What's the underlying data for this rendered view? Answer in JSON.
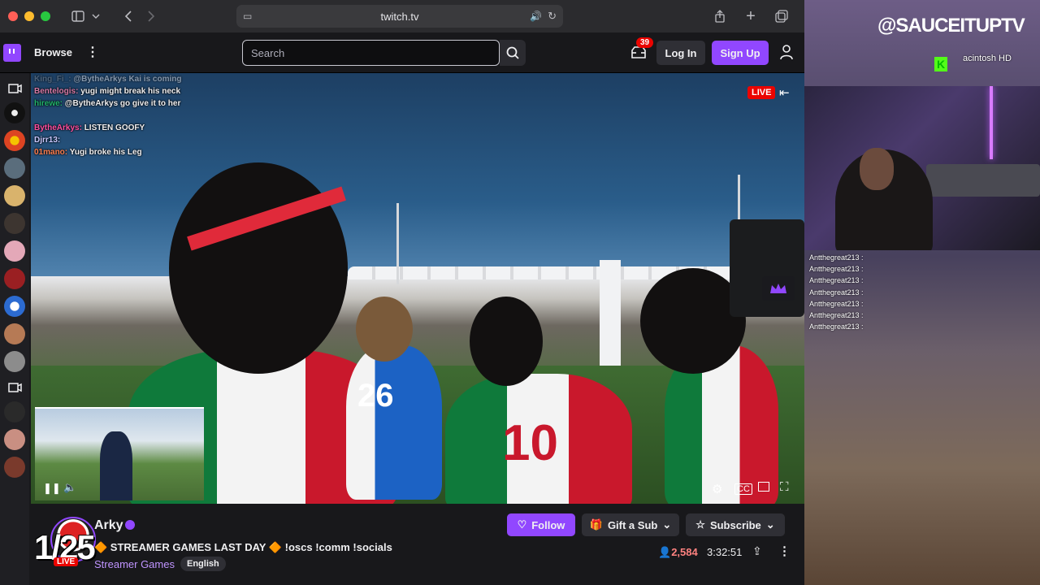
{
  "browser": {
    "url": "twitch.tv",
    "colors": {
      "close": "#ff5f57",
      "minimize": "#febc2e",
      "zoom": "#28c840"
    }
  },
  "nav": {
    "browse_label": "Browse",
    "search_placeholder": "Search",
    "notification_count": "39",
    "login_label": "Log In",
    "signup_label": "Sign Up"
  },
  "player": {
    "live_label": "LIVE",
    "chat_lines": [
      {
        "user": "King_Fi_:",
        "msg": "@BytheArkys Kai is coming",
        "color": "#6b7a8a"
      },
      {
        "user": "Bentelogis:",
        "msg": "yugi might break his neck",
        "color": "#d77aa6"
      },
      {
        "user": "hirewe:",
        "msg": "@BytheArkys go give it to her",
        "color": "#21b36b"
      },
      {
        "user": "BytheArkys:",
        "msg": "LISTEN GOOFY",
        "color": "#ff4fa0"
      },
      {
        "user": "Djrr13:",
        "msg": "",
        "color": "#c8c8ff"
      },
      {
        "user": "01mano:",
        "msg": "Yugi broke his Leg",
        "color": "#ff7f50"
      }
    ],
    "jersey_numbers": [
      "26",
      "10"
    ]
  },
  "channel": {
    "name": "Arky",
    "rank_overlay": "1/25",
    "live_label": "LIVE",
    "title": "🔶 STREAMER GAMES LAST DAY 🔶 !oscs !comm !socials",
    "category": "Streamer Games",
    "language": "English",
    "follow_label": "Follow",
    "gift_label": "Gift a Sub",
    "subscribe_label": "Subscribe",
    "viewers": "2,584",
    "uptime": "3:32:51"
  },
  "overlay": {
    "brand": "@SAUCEITUPTV",
    "drive_label": "acintosh HD",
    "chat_user": "Antthegreat213 :",
    "chat_count": 7
  }
}
